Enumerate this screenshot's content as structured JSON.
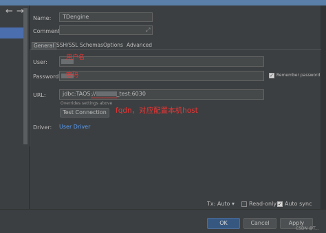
{
  "nav": {
    "back_glyph": "←",
    "forward_glyph": "→"
  },
  "form": {
    "name_label": "Name:",
    "name_value": "TDengine",
    "comment_label": "Comment:",
    "comment_expand_glyph": "⤢"
  },
  "tabs": [
    {
      "label": "General"
    },
    {
      "label": "SSH/SSL"
    },
    {
      "label": "Schemas"
    },
    {
      "label": "Options"
    },
    {
      "label": "Advanced"
    }
  ],
  "general": {
    "user_label": "User:",
    "user_annotation": "用户名",
    "password_label": "Password:",
    "password_annotation": "密码",
    "remember_label": "Remember password",
    "url_label": "URL:",
    "url_prefix": "jdbc:TAOS://",
    "url_suffix": "_test:6030",
    "url_hint": "Overrides settings above",
    "test_connection": "Test Connection",
    "fqdn_note": "fqdn，对应配置本机host",
    "driver_label": "Driver:",
    "driver_link": "User Driver"
  },
  "options": {
    "tx_label": "Tx: Auto",
    "tx_arrow": "▾",
    "readonly_label": "Read-only",
    "autosync_label": "Auto sync"
  },
  "footer": {
    "ok": "OK",
    "cancel": "Cancel",
    "apply": "Apply",
    "watermark": "CSDN @T..."
  },
  "colors": {
    "accent": "#365880",
    "annotation": "#ee3333",
    "link": "#589df6"
  }
}
